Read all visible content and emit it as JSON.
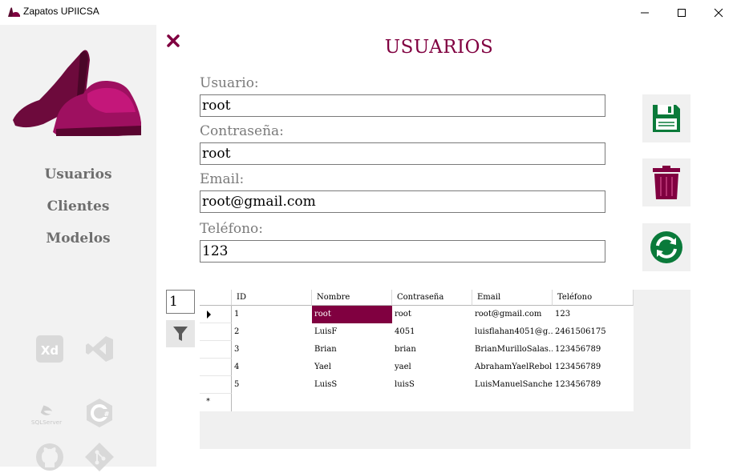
{
  "window": {
    "title": "Zapatos UPIICSA"
  },
  "sidebar": {
    "nav": [
      {
        "label": "Usuarios"
      },
      {
        "label": "Clientes"
      },
      {
        "label": "Modelos"
      }
    ]
  },
  "form": {
    "title": "USUARIOS",
    "fields": [
      {
        "label": "Usuario:",
        "value": "root"
      },
      {
        "label": "Contraseña:",
        "value": "root"
      },
      {
        "label": "Email:",
        "value": "root@gmail.com"
      },
      {
        "label": "Teléfono:",
        "value": "123"
      }
    ]
  },
  "grid": {
    "columns": [
      "ID",
      "Nombre",
      "Contraseña",
      "Email",
      "Teléfono"
    ],
    "rows": [
      [
        "1",
        "root",
        "root",
        "root@gmail.com",
        "123"
      ],
      [
        "2",
        "LuisF",
        "4051",
        "luisflahan4051@g...",
        "2461506175"
      ],
      [
        "3",
        "Brian",
        "brian",
        "BrianMurilloSalas...",
        "123456789"
      ],
      [
        "4",
        "Yael",
        "yael",
        "AbrahamYaelRebol...",
        "123456789"
      ],
      [
        "5",
        "LuisS",
        "luisS",
        "LuisManuelSanche...",
        "123456789"
      ]
    ],
    "new_row_marker": "*"
  },
  "pager": {
    "value": "1"
  },
  "colors": {
    "accent": "#800040",
    "save": "#0a7a3a",
    "delete": "#800040",
    "refresh": "#0a7a3a"
  },
  "icons": [
    "app-shoe-icon",
    "minimize-icon",
    "maximize-icon",
    "close-window-icon",
    "close-icon",
    "save-disk-icon",
    "trash-icon",
    "refresh-icon",
    "filter-icon",
    "adobe-xd-icon",
    "visual-studio-icon",
    "sql-server-icon",
    "csharp-icon",
    "github-icon",
    "git-icon"
  ]
}
